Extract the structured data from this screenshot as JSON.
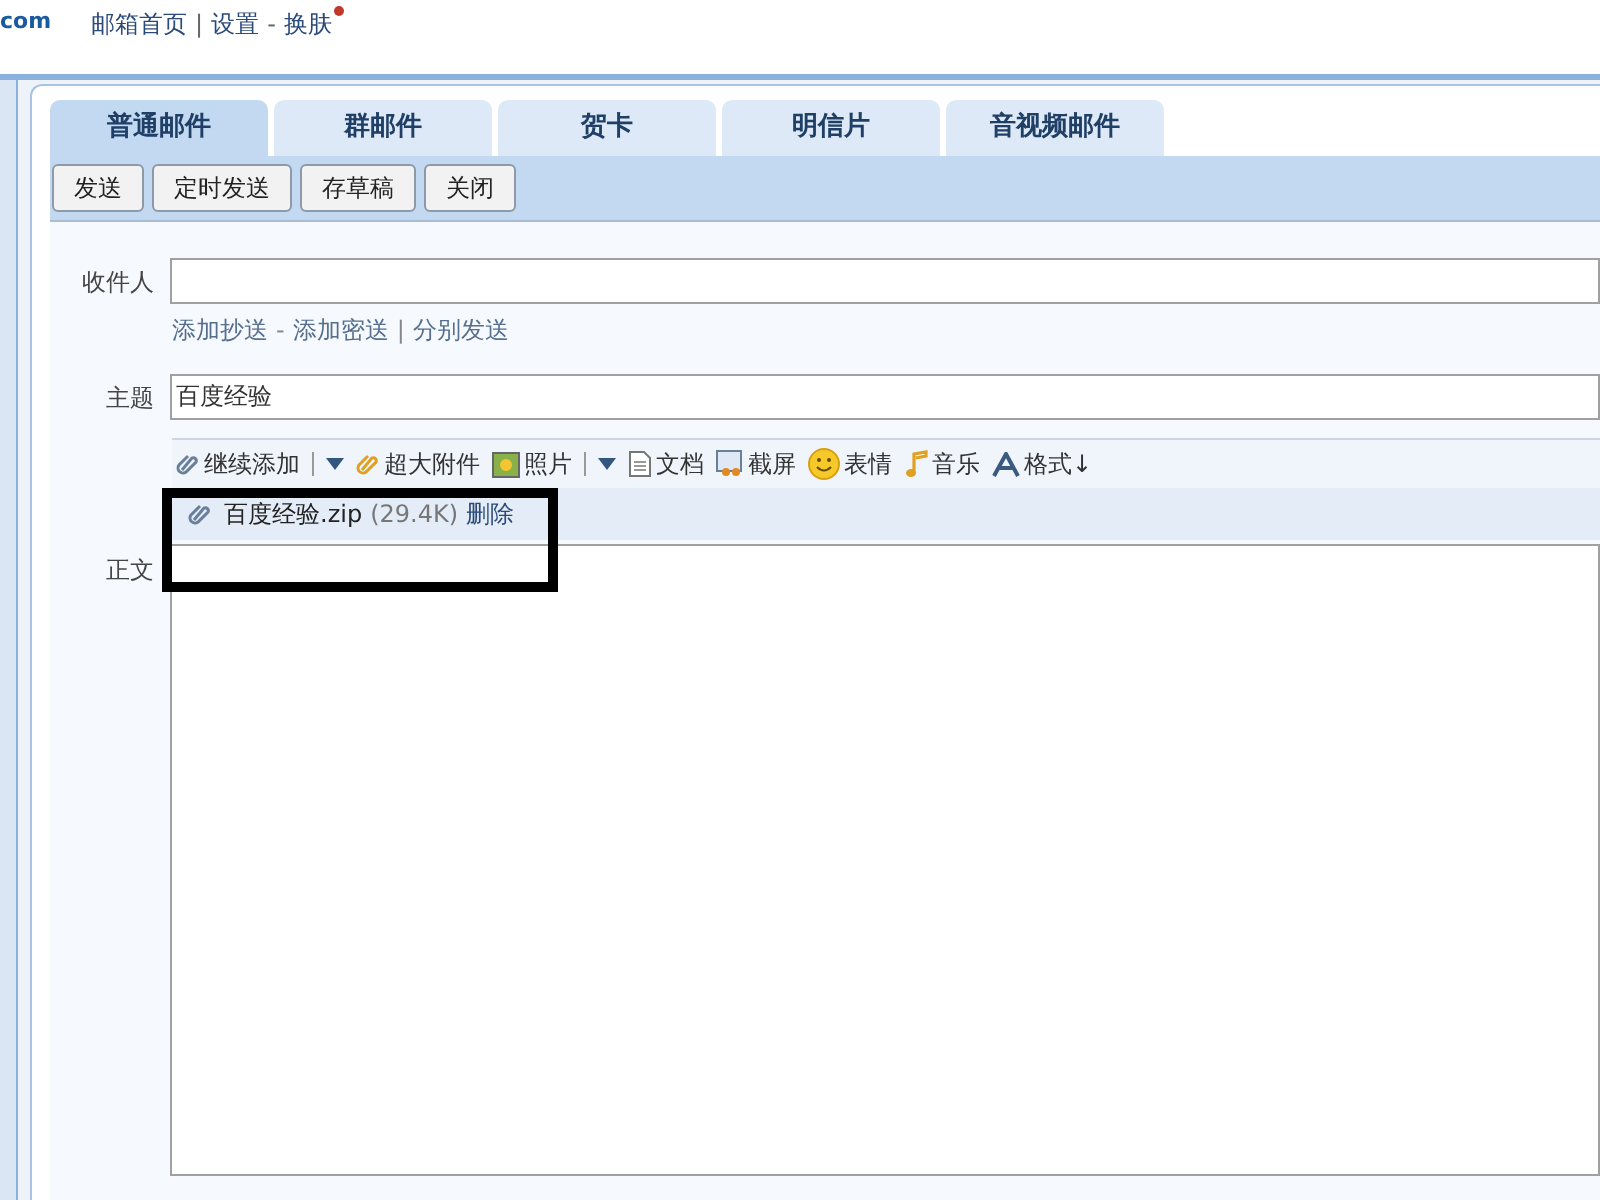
{
  "logo": {
    "text": "com"
  },
  "top_links": [
    {
      "label": "邮箱首页",
      "sep": "|"
    },
    {
      "label": "设置",
      "sep": "-"
    },
    {
      "label": "换肤",
      "badge": true
    }
  ],
  "tabs": [
    {
      "label": "普通邮件",
      "selected": true
    },
    {
      "label": "群邮件",
      "selected": false
    },
    {
      "label": "贺卡",
      "selected": false
    },
    {
      "label": "明信片",
      "selected": false
    },
    {
      "label": "音视频邮件",
      "selected": false
    }
  ],
  "actions": [
    "发送",
    "定时发送",
    "存草稿",
    "关闭"
  ],
  "recipient": {
    "label": "收件人"
  },
  "recipient_links": [
    {
      "label": "添加抄送",
      "sep": "-"
    },
    {
      "label": "添加密送",
      "sep": "|"
    },
    {
      "label": "分别发送"
    }
  ],
  "subject": {
    "label": "主题",
    "value": "百度经验"
  },
  "attach_tools": [
    {
      "kind": "clip",
      "label": "继续添加",
      "menu": true
    },
    {
      "kind": "bigclip",
      "label": "超大附件",
      "menu": false
    },
    {
      "kind": "photo",
      "label": "照片",
      "menu": true
    },
    {
      "kind": "doc",
      "label": "文档",
      "menu": false
    },
    {
      "kind": "screen",
      "label": "截屏",
      "menu": false
    },
    {
      "kind": "smile",
      "label": "表情",
      "menu": false
    },
    {
      "kind": "music",
      "label": "音乐",
      "menu": false
    },
    {
      "kind": "font",
      "label": "格式↓",
      "menu": false
    }
  ],
  "attachments": [
    {
      "name": "百度经验.zip",
      "size": "(29.4K)",
      "remove": "删除"
    }
  ],
  "body": {
    "label": "正文"
  },
  "highlight": true
}
